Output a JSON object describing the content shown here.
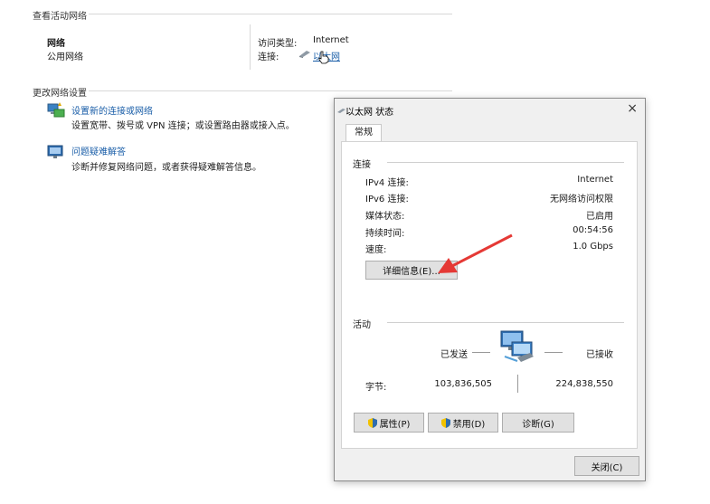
{
  "active_networks": {
    "section_title": "查看活动网络",
    "network_name": "网络",
    "network_type": "公用网络",
    "access_type_label": "访问类型:",
    "access_type_value": "Internet",
    "connections_label": "连接:",
    "connection_link": "以太网"
  },
  "change_settings": {
    "section_title": "更改网络设置",
    "items": [
      {
        "link": "设置新的连接或网络",
        "desc": "设置宽带、拨号或 VPN 连接；或设置路由器或接入点。",
        "icon": "network-setup-icon"
      },
      {
        "link": "问题疑难解答",
        "desc": "诊断并修复网络问题，或者获得疑难解答信息。",
        "icon": "troubleshoot-icon"
      }
    ]
  },
  "dialog": {
    "title": "以太网 状态",
    "close_glyph": "×",
    "tab": "常规",
    "connection_group": "连接",
    "rows": [
      {
        "label": "IPv4 连接:",
        "value": "Internet"
      },
      {
        "label": "IPv6 连接:",
        "value": "无网络访问权限"
      },
      {
        "label": "媒体状态:",
        "value": "已启用"
      },
      {
        "label": "持续时间:",
        "value": "00:54:56"
      },
      {
        "label": "速度:",
        "value": "1.0 Gbps"
      }
    ],
    "details_button": "详细信息(E)...",
    "activity_group": "活动",
    "sent_label": "已发送",
    "received_label": "已接收",
    "bytes_label": "字节:",
    "bytes_sent": "103,836,505",
    "bytes_received": "224,838,550",
    "properties_button": "属性(P)",
    "disable_button": "禁用(D)",
    "diagnose_button": "诊断(G)",
    "close_button": "关闭(C)"
  },
  "colors": {
    "link": "#1a5ea8",
    "arrow": "#e53935"
  }
}
